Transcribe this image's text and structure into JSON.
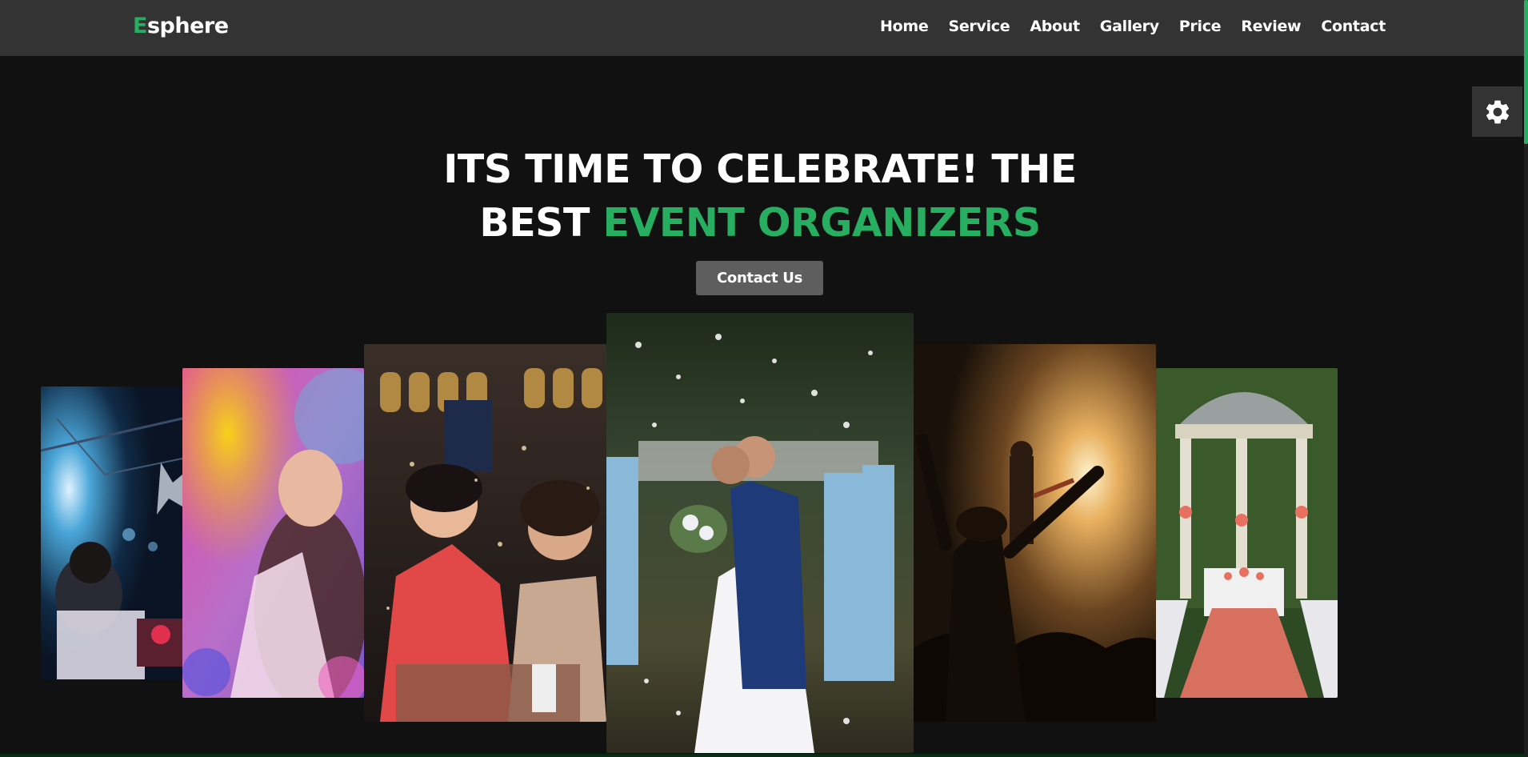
{
  "header": {
    "logo_first_letter": "E",
    "logo_rest": "sphere",
    "nav": [
      {
        "label": "Home"
      },
      {
        "label": "Service"
      },
      {
        "label": "About"
      },
      {
        "label": "Gallery"
      },
      {
        "label": "Price"
      },
      {
        "label": "Review"
      },
      {
        "label": "Contact"
      }
    ]
  },
  "settings": {
    "icon": "gear-icon"
  },
  "hero": {
    "title_line1": "ITS TIME TO CELEBRATE! THE",
    "title_line2_white": "BEST ",
    "title_line2_green": "EVENT ORGANIZERS",
    "cta_label": "Contact Us"
  },
  "gallery": [
    {
      "name": "dj-party-photo"
    },
    {
      "name": "color-festival-photo"
    },
    {
      "name": "birthday-party-photo"
    },
    {
      "name": "wedding-couple-photo"
    },
    {
      "name": "concert-crowd-photo"
    },
    {
      "name": "wedding-gazebo-photo"
    }
  ],
  "colors": {
    "accent": "#27ae60",
    "header_bg": "#333333",
    "page_bg": "#111111",
    "button_bg": "#5e5e5e"
  }
}
